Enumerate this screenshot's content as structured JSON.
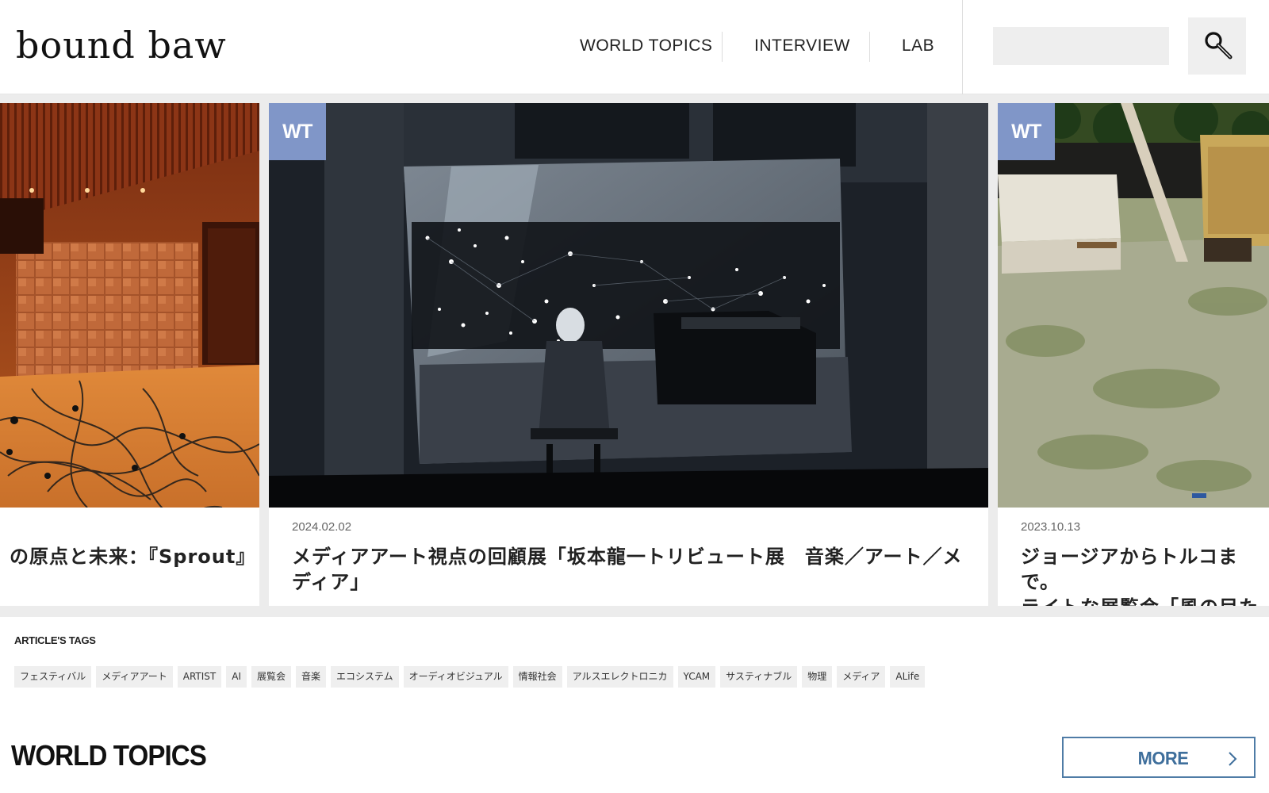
{
  "header": {
    "logo_text": "bound baw",
    "nav": [
      {
        "label": "WORLD TOPICS"
      },
      {
        "label": "INTERVIEW"
      },
      {
        "label": "LAB"
      }
    ],
    "search": {
      "placeholder": "",
      "value": ""
    }
  },
  "carousel": {
    "cards": [
      {
        "badge": "",
        "date": "",
        "title": "の原点と未来：『Sprout』"
      },
      {
        "badge": "WT",
        "date": "2024.02.02",
        "title": "メディアアート視点の回顧展「坂本龍一トリビュート展　音楽／アート／メ\nディア」"
      },
      {
        "badge": "WT",
        "date": "2023.10.13",
        "title": "ジョージアからトルコまで。\nライトな展覧会「風の目たち"
      }
    ]
  },
  "tags_section": {
    "heading": "ARTICLE'S TAGS",
    "tags": [
      "フェスティバル",
      "メディアアート",
      "ARTIST",
      "AI",
      "展覧会",
      "音楽",
      "エコシステム",
      "オーディオビジュアル",
      "情報社会",
      "アルスエレクトロニカ",
      "YCAM",
      "サスティナブル",
      "物理",
      "メディア",
      "ALife"
    ]
  },
  "section": {
    "title": "WORLD TOPICS",
    "more_label": "MORE"
  },
  "colors": {
    "badge": "#8096c8",
    "more_border": "#4f7ca6",
    "more_text": "#3f6f9c"
  },
  "icons": {
    "search": "magnifier-icon",
    "more": "chevron-right-icon"
  }
}
